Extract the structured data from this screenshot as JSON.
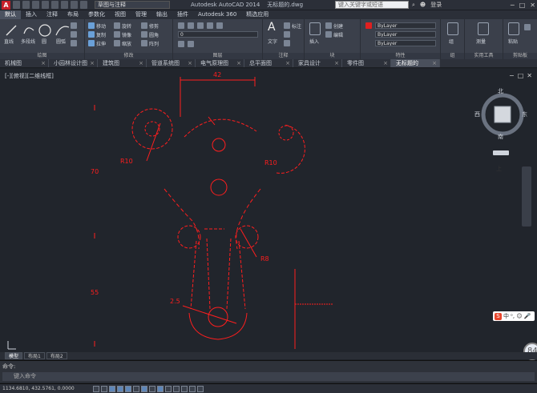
{
  "title_bar": {
    "logo": "A",
    "workspace": "草图与注释",
    "app_title": "Autodesk AutoCAD 2014",
    "file_name": "无标题的.dwg",
    "search_placeholder": "键入关键字或短语",
    "user": "登录",
    "window_controls": [
      "─",
      "□",
      "✕"
    ]
  },
  "menu_tabs": [
    "默认",
    "插入",
    "注释",
    "布局",
    "参数化",
    "视图",
    "管理",
    "输出",
    "插件",
    "Autodesk 360",
    "精选应用"
  ],
  "ribbon": {
    "panels": [
      "绘图",
      "修改",
      "图层",
      "注释",
      "块",
      "特性",
      "组",
      "实用工具",
      "剪贴板"
    ],
    "draw_tools": [
      "直线",
      "多段线",
      "圆",
      "圆弧"
    ],
    "modify_tools": [
      "移动",
      "旋转",
      "修剪",
      "复制",
      "镜像",
      "圆角",
      "拉伸",
      "缩放",
      "阵列"
    ],
    "layer_value": "0",
    "annotation_labels": [
      "文字",
      "标注"
    ],
    "block_labels": [
      "插入",
      "创建",
      "编辑"
    ],
    "properties": {
      "color": "ByLayer",
      "linetype": "ByLayer",
      "lineweight": "ByLayer"
    },
    "group_label": "组",
    "utility_label": "测量",
    "clipboard_label": "粘贴"
  },
  "file_tabs": [
    "机械图",
    "小园林设计图",
    "建筑图",
    "管道系统图",
    "电气原理图",
    "总平面图",
    "家具设计",
    "零件图",
    "无标题的"
  ],
  "viewport": {
    "label": "[-][俯视][二维线框]",
    "controls": [
      "−",
      "□",
      "✕"
    ],
    "viewcube": {
      "top": "上",
      "north": "北",
      "south": "南",
      "east": "东",
      "west": "西"
    }
  },
  "drawing": {
    "color": "#ff1e1e",
    "dims": [
      "R10",
      "70",
      "R8",
      "55",
      "R10",
      "2.5",
      "42"
    ]
  },
  "layout_tabs": [
    "模型",
    "布局1",
    "布局2"
  ],
  "command": {
    "history": "命令:",
    "prompt": "键入命令"
  },
  "status_bar": {
    "coords": "1134.6810, 432.5761, 0.0000"
  },
  "ime": {
    "label": "中",
    "extras": "ᵒ, ☺ 🎤"
  },
  "badge": "84"
}
